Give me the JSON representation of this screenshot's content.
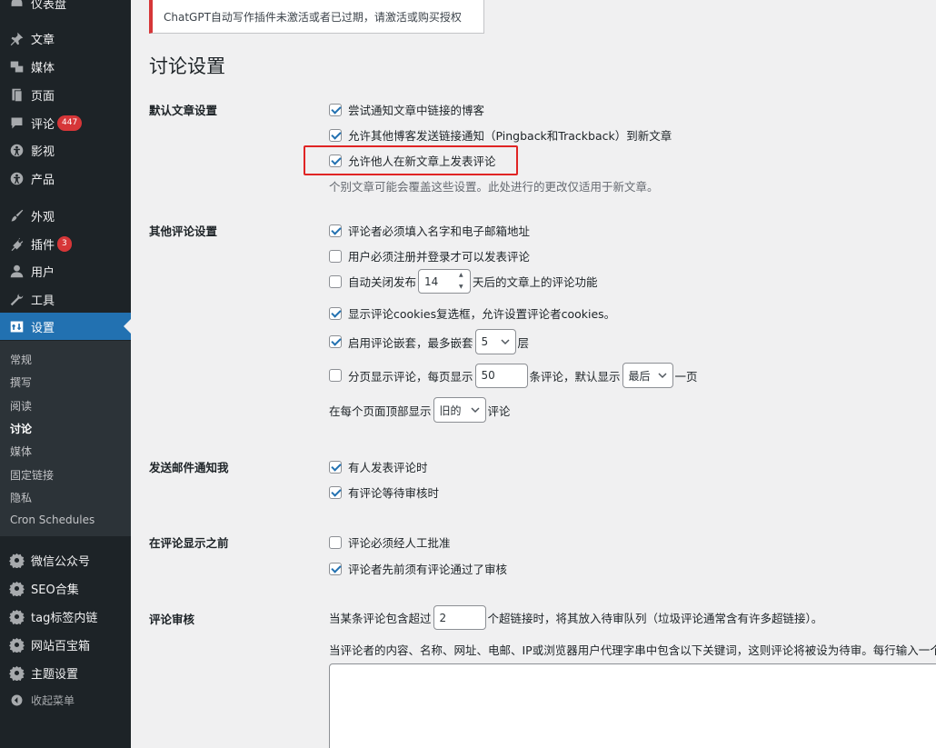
{
  "sidebar": {
    "items": [
      {
        "label": "仪表盘",
        "icon": "dashboard-icon"
      },
      {
        "label": "文章",
        "icon": "pin-icon"
      },
      {
        "label": "媒体",
        "icon": "media-icon"
      },
      {
        "label": "页面",
        "icon": "page-icon"
      },
      {
        "label": "评论",
        "icon": "comment-icon",
        "badge": "447"
      },
      {
        "label": "影视",
        "icon": "accessibility-icon"
      },
      {
        "label": "产品",
        "icon": "accessibility-icon"
      },
      {
        "label": "外观",
        "icon": "brush-icon"
      },
      {
        "label": "插件",
        "icon": "plugin-icon",
        "badge": "3"
      },
      {
        "label": "用户",
        "icon": "user-icon"
      },
      {
        "label": "工具",
        "icon": "wrench-icon"
      },
      {
        "label": "设置",
        "icon": "settings-icon"
      }
    ],
    "submenu": [
      "常规",
      "撰写",
      "阅读",
      "讨论",
      "媒体",
      "固定链接",
      "隐私",
      "Cron Schedules"
    ],
    "extra_items": [
      {
        "label": "微信公众号",
        "icon": "gear-icon"
      },
      {
        "label": "SEO合集",
        "icon": "gear-icon"
      },
      {
        "label": "tag标签内链",
        "icon": "gear-icon"
      },
      {
        "label": "网站百宝箱",
        "icon": "gear-icon"
      },
      {
        "label": "主题设置",
        "icon": "gear-icon"
      }
    ],
    "collapse_label": "收起菜单"
  },
  "notice": "ChatGPT自动写作插件未激活或者已过期，请激活或购买授权",
  "page_title": "讨论设置",
  "sections": {
    "default_article": {
      "label": "默认文章设置",
      "options": [
        {
          "label": "尝试通知文章中链接的博客",
          "checked": true
        },
        {
          "label": "允许其他博客发送链接通知（Pingback和Trackback）到新文章",
          "checked": true
        },
        {
          "label": "允许他人在新文章上发表评论",
          "checked": true
        }
      ],
      "description": "个别文章可能会覆盖这些设置。此处进行的更改仅适用于新文章。"
    },
    "other_comment": {
      "label": "其他评论设置",
      "require_name_email": "评论者必须填入名字和电子邮箱地址",
      "require_registration": "用户必须注册并登录才可以发表评论",
      "auto_close_prefix": "自动关闭发布",
      "auto_close_days": "14",
      "auto_close_suffix": "天后的文章上的评论功能",
      "cookies": "显示评论cookies复选框，允许设置评论者cookies。",
      "threaded_prefix": "启用评论嵌套，最多嵌套",
      "threaded_depth": "5",
      "threaded_suffix": "层",
      "paged_prefix": "分页显示评论，每页显示",
      "paged_count": "50",
      "paged_middle": "条评论，默认显示",
      "paged_default": "最后",
      "paged_suffix": "一页",
      "order_prefix": "在每个页面顶部显示",
      "order_value": "旧的",
      "order_suffix": "评论"
    },
    "email_me": {
      "label": "发送邮件通知我",
      "on_comment": "有人发表评论时",
      "on_moderation": "有评论等待审核时"
    },
    "before_appear": {
      "label": "在评论显示之前",
      "manual_approval": "评论必须经人工批准",
      "previously_approved": "评论者先前须有评论通过了审核"
    },
    "moderation": {
      "label": "评论审核",
      "links_prefix": "当某条评论包含超过",
      "links_count": "2",
      "links_suffix": "个超链接时，将其放入待审队列（垃圾评论通常含有许多超链接）。",
      "keys_description": "当评论者的内容、名称、网址、电邮、IP或浏览器用户代理字串中包含以下关键词，这则评论将被设为待审。每行输入一个"
    }
  },
  "colors": {
    "sidebar_bg": "#1d2327",
    "active_bg": "#2271b1",
    "badge_bg": "#d63638",
    "highlight_border": "#e02424"
  }
}
